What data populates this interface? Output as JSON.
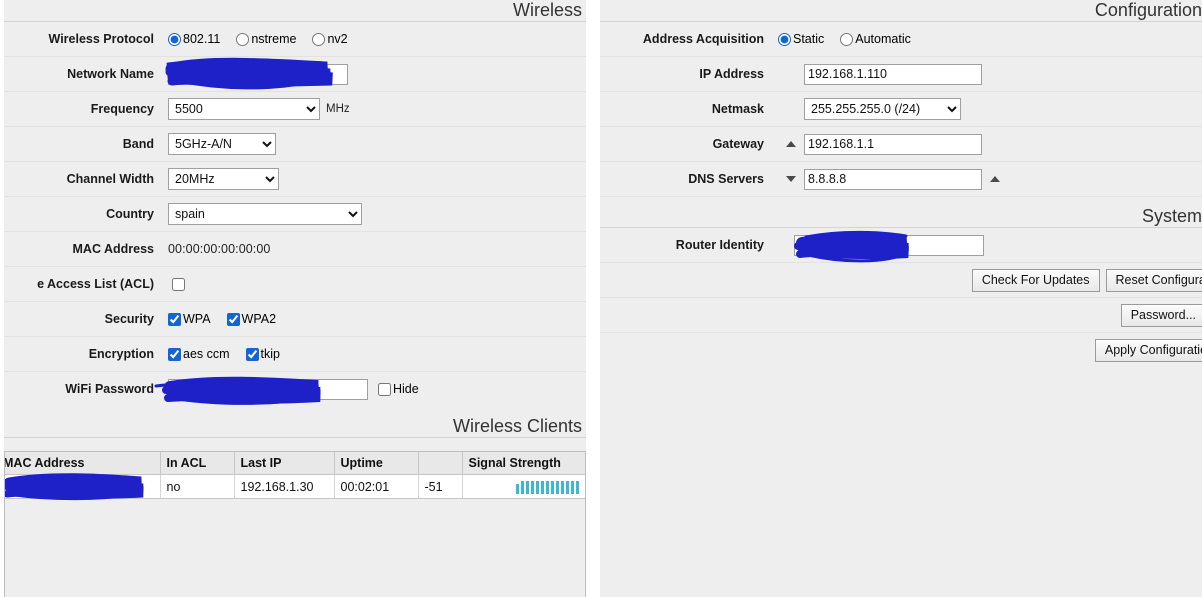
{
  "wireless": {
    "section_title": "Wireless",
    "protocol": {
      "label": "Wireless Protocol",
      "options": [
        "802.11",
        "nstreme",
        "nv2"
      ],
      "selected": "802.11"
    },
    "network_name": {
      "label": "Network Name",
      "value": "",
      "redacted": true
    },
    "frequency": {
      "label": "Frequency",
      "value": "5500",
      "unit": "MHz",
      "options": [
        "5500"
      ]
    },
    "band": {
      "label": "Band",
      "value": "5GHz-A/N",
      "options": [
        "5GHz-A/N"
      ]
    },
    "channel_width": {
      "label": "Channel Width",
      "value": "20MHz",
      "options": [
        "20MHz"
      ]
    },
    "country": {
      "label": "Country",
      "value": "spain",
      "options": [
        "spain"
      ]
    },
    "mac_address": {
      "label": "MAC Address",
      "value": "00:00:00:00:00:00"
    },
    "acl": {
      "label": "e Access List (ACL)",
      "full_label": "Use Access List (ACL)",
      "checked": false
    },
    "security": {
      "label": "Security",
      "options": [
        {
          "label": "WPA",
          "checked": true
        },
        {
          "label": "WPA2",
          "checked": true
        }
      ]
    },
    "encryption": {
      "label": "Encryption",
      "options": [
        {
          "label": "aes ccm",
          "checked": true
        },
        {
          "label": "tkip",
          "checked": true
        }
      ]
    },
    "wifi_password": {
      "label": "WiFi Password",
      "value": "",
      "redacted": true
    },
    "hide": {
      "label": "Hide",
      "checked": false
    }
  },
  "clients": {
    "section_title": "Wireless Clients",
    "columns": [
      "MAC Address",
      "In ACL",
      "Last IP",
      "Uptime",
      "",
      "Signal Strength"
    ],
    "rows": [
      {
        "mac_address": "",
        "mac_redacted": true,
        "in_acl": "no",
        "last_ip": "192.168.1.30",
        "uptime": "00:02:01",
        "signal_dbm": "-51",
        "signal_bars": 13
      }
    ]
  },
  "configuration": {
    "section_title": "Configuration",
    "address_acquisition": {
      "label": "Address Acquisition",
      "options": [
        "Static",
        "Automatic"
      ],
      "selected": "Static"
    },
    "ip_address": {
      "label": "IP Address",
      "value": "192.168.1.110"
    },
    "netmask": {
      "label": "Netmask",
      "value": "255.255.255.0 (/24)",
      "options": [
        "255.255.255.0 (/24)"
      ]
    },
    "gateway": {
      "label": "Gateway",
      "value": "192.168.1.1",
      "left_icon": "triangle-up-icon"
    },
    "dns_servers": {
      "label": "DNS Servers",
      "value": "8.8.8.8",
      "left_icon": "triangle-down-icon",
      "right_icon": "triangle-up-icon"
    }
  },
  "system": {
    "section_title": "System",
    "router_identity": {
      "label": "Router Identity",
      "value": "",
      "redacted": true
    },
    "buttons": {
      "check_for_updates": "Check For Updates",
      "reset_configuration": "Reset Configuration",
      "password": "Password...",
      "apply_configuration": "Apply Configuration"
    }
  },
  "colors": {
    "panel_bg": "#eeeeee",
    "page_bg": "#ffffff",
    "accent_blue": "#1464d2",
    "signal_bar": "#3bb8d8",
    "redaction": "#1f21c8",
    "row_divider": "#e2e2e2"
  }
}
